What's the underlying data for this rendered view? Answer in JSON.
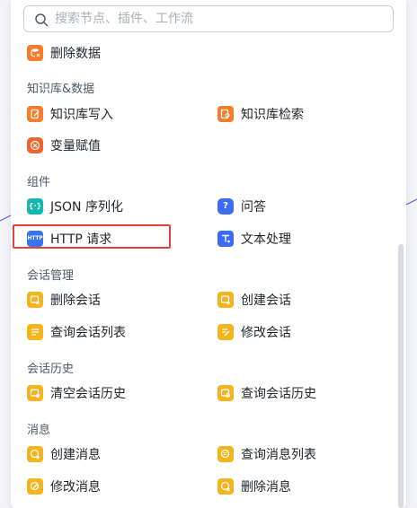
{
  "search": {
    "placeholder": "搜索节点、插件、工作流"
  },
  "top_item": {
    "label": "删除数据",
    "icon": "delete-data-icon"
  },
  "sections": [
    {
      "title": "知识库&数据",
      "items": [
        {
          "label": "知识库写入",
          "icon": "knowledge-write-icon"
        },
        {
          "label": "知识库检索",
          "icon": "knowledge-search-icon"
        },
        {
          "label": "变量赋值",
          "icon": "variable-assign-icon"
        }
      ]
    },
    {
      "title": "组件",
      "items": [
        {
          "label": "JSON 序列化",
          "icon": "json-icon",
          "glyph": "{·}"
        },
        {
          "label": "问答",
          "icon": "question-icon",
          "glyph": "?"
        },
        {
          "label": "HTTP 请求",
          "icon": "http-icon",
          "glyph": "HTTP"
        },
        {
          "label": "文本处理",
          "icon": "text-process-icon"
        }
      ]
    },
    {
      "title": "会话管理",
      "items": [
        {
          "label": "删除会话",
          "icon": "delete-conversation-icon"
        },
        {
          "label": "创建会话",
          "icon": "create-conversation-icon"
        },
        {
          "label": "查询会话列表",
          "icon": "query-conversation-list-icon"
        },
        {
          "label": "修改会话",
          "icon": "edit-conversation-icon"
        }
      ]
    },
    {
      "title": "会话历史",
      "items": [
        {
          "label": "清空会话历史",
          "icon": "clear-history-icon"
        },
        {
          "label": "查询会话历史",
          "icon": "query-history-icon"
        }
      ]
    },
    {
      "title": "消息",
      "items": [
        {
          "label": "创建消息",
          "icon": "create-message-icon"
        },
        {
          "label": "查询消息列表",
          "icon": "query-message-list-icon"
        },
        {
          "label": "修改消息",
          "icon": "edit-message-icon"
        },
        {
          "label": "删除消息",
          "icon": "delete-message-icon"
        }
      ]
    }
  ],
  "colors": {
    "orange": "#f77d2a",
    "teal": "#14b8b0",
    "blue": "#3b6cf6",
    "yellow": "#f5b41c",
    "highlight": "#e0443a"
  }
}
